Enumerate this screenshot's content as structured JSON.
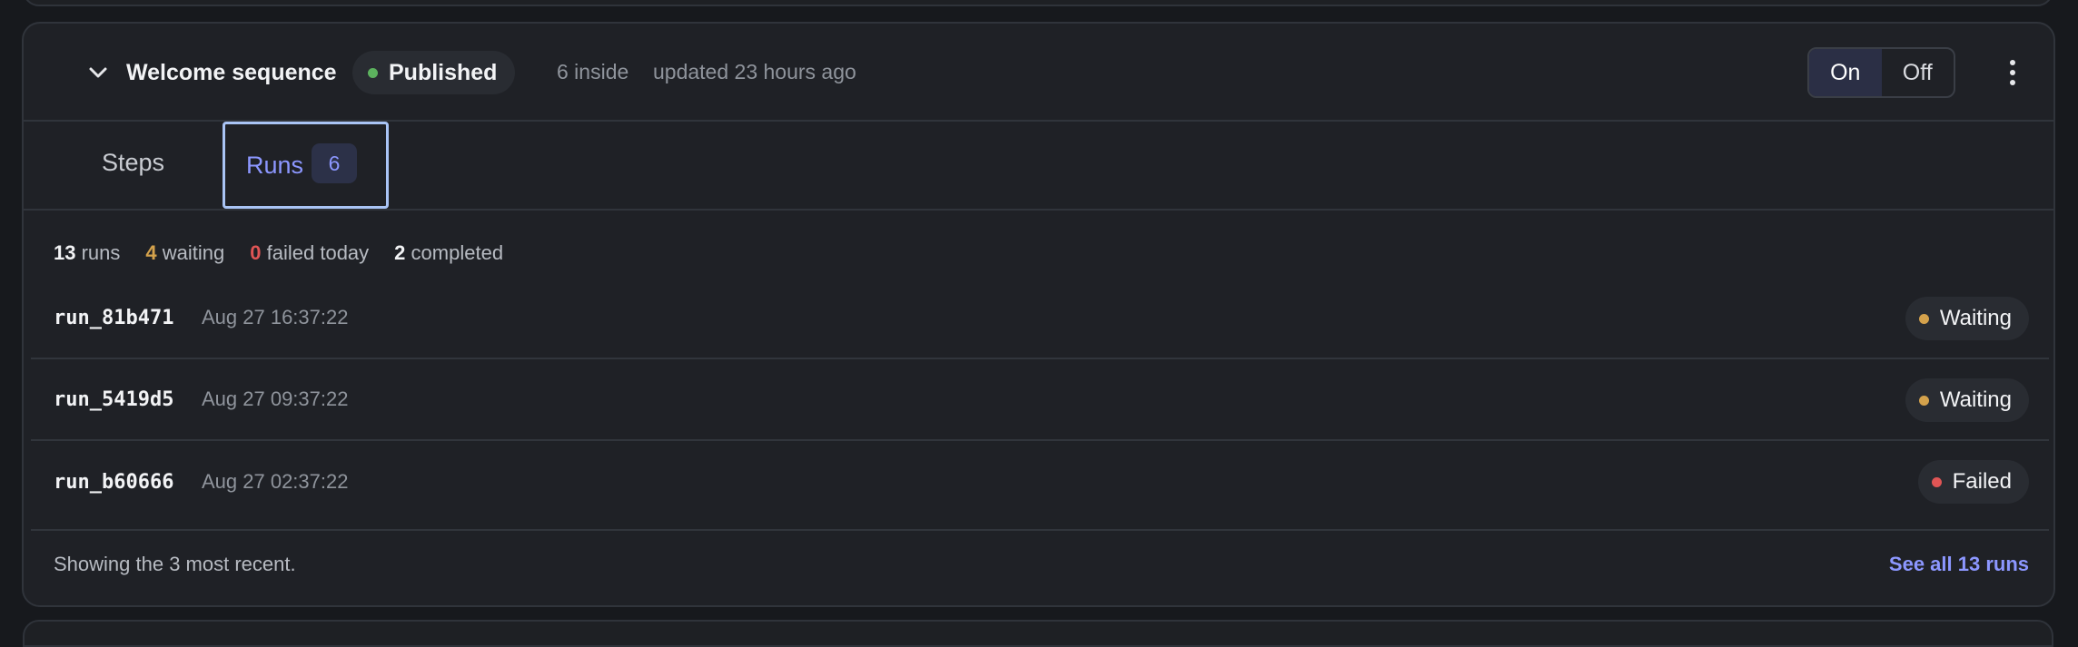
{
  "colors": {
    "published": "#5cb25e",
    "waiting": "#d4a24c",
    "failed": "#e05555",
    "accent": "#8c97ff"
  },
  "header": {
    "collapse_icon": "chevron-down-icon",
    "title": "Welcome sequence",
    "status": "Published",
    "count_text": "6 inside",
    "updated_text": "updated 23 hours ago",
    "toggle": {
      "on_label": "On",
      "off_label": "Off",
      "selected": "On"
    },
    "menu_icon": "more-vertical-icon"
  },
  "tabs": [
    {
      "label": "Steps",
      "active": false
    },
    {
      "label": "Runs",
      "count": "6",
      "active": true
    }
  ],
  "stats": {
    "runs_count": "13",
    "runs_label": "runs",
    "waiting_count": "4",
    "waiting_label": "waiting",
    "failed_count": "0",
    "failed_label": "failed today",
    "completed_count": "2",
    "completed_label": "completed"
  },
  "runs": [
    {
      "id": "run_81b471",
      "time": "Aug 27 16:37:22",
      "status": "Waiting"
    },
    {
      "id": "run_5419d5",
      "time": "Aug 27 09:37:22",
      "status": "Waiting"
    },
    {
      "id": "run_b60666",
      "time": "Aug 27 02:37:22",
      "status": "Failed"
    }
  ],
  "footer": {
    "note": "Showing the 3 most recent.",
    "link": "See all 13 runs"
  }
}
